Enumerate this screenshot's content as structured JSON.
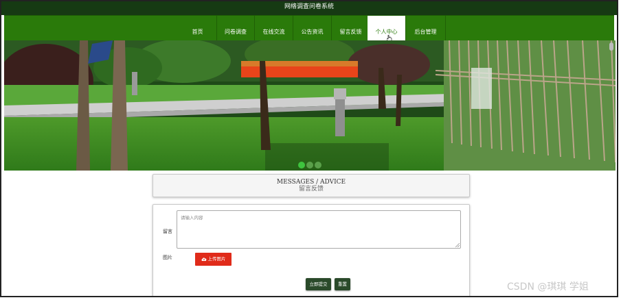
{
  "app": {
    "title": "网络调查问卷系统"
  },
  "nav": {
    "items": [
      {
        "label": "首页",
        "active": false
      },
      {
        "label": "问卷调查",
        "active": false
      },
      {
        "label": "在线交流",
        "active": false
      },
      {
        "label": "公告资讯",
        "active": false
      },
      {
        "label": "留言反馈",
        "active": false
      },
      {
        "label": "个人中心",
        "active": true
      },
      {
        "label": "后台管理",
        "active": false
      }
    ]
  },
  "banner": {
    "slide_count": 3,
    "active_slide": 1
  },
  "section": {
    "title_en": "MESSAGES / ADVICE",
    "title_cn": "留言反馈"
  },
  "form": {
    "message_label": "留言",
    "message_placeholder": "请输入内容",
    "message_value": "",
    "image_label": "图片",
    "upload_label": "上传图片",
    "submit_label": "立即提交",
    "reset_label": "重置"
  },
  "watermark": "CSDN @琪琪 学姐",
  "colors": {
    "title_bar": "#163a13",
    "nav": "#2a7a0a",
    "accent_red": "#e02b1a",
    "button": "#2a4a2a"
  }
}
